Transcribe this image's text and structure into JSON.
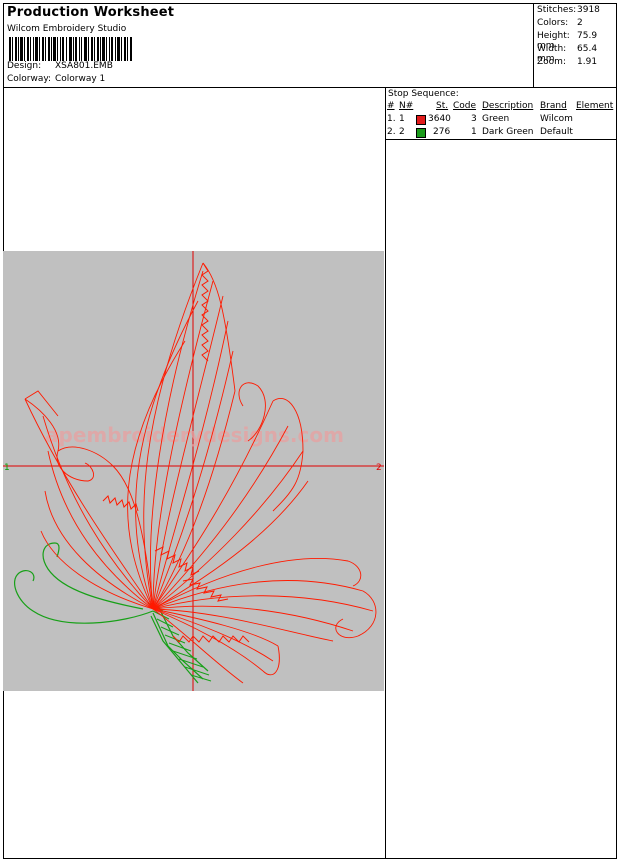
{
  "header": {
    "title": "Production Worksheet",
    "software": "Wilcom  Embroidery Studio",
    "design_label": "Design:",
    "design_value": "XSA801.EMB",
    "colorway_label": "Colorway:",
    "colorway_value": "Colorway 1"
  },
  "stats": [
    {
      "label": "Stitches:",
      "value": "3918"
    },
    {
      "label": "Colors:",
      "value": "2"
    },
    {
      "label": "Height:",
      "value": "75.9 mm"
    },
    {
      "label": "Width:",
      "value": "65.4 mm"
    },
    {
      "label": "Zoom:",
      "value": "1.91"
    }
  ],
  "stop_sequence": {
    "caption": "Stop Sequence:",
    "columns": {
      "num": "#",
      "needle": "N#",
      "st": "St.",
      "code": "Code",
      "description": "Description",
      "brand": "Brand",
      "element": "Element"
    },
    "rows": [
      {
        "num": "1.",
        "needle": "1",
        "color": "#e21b1b",
        "st": "3640",
        "code": "3",
        "description": "Green",
        "brand": "Wilcom"
      },
      {
        "num": "2.",
        "needle": "2",
        "color": "#1a9a1a",
        "st": "276",
        "code": "1",
        "description": "Dark Green",
        "brand": "Default"
      }
    ]
  },
  "canvas": {
    "axis_left_label": "1",
    "axis_right_label": "2",
    "watermark": "apembroiderydesigns.com",
    "background": "#c0c0c0",
    "stitch_red": "#ff1a00",
    "stitch_green": "#18a018"
  }
}
